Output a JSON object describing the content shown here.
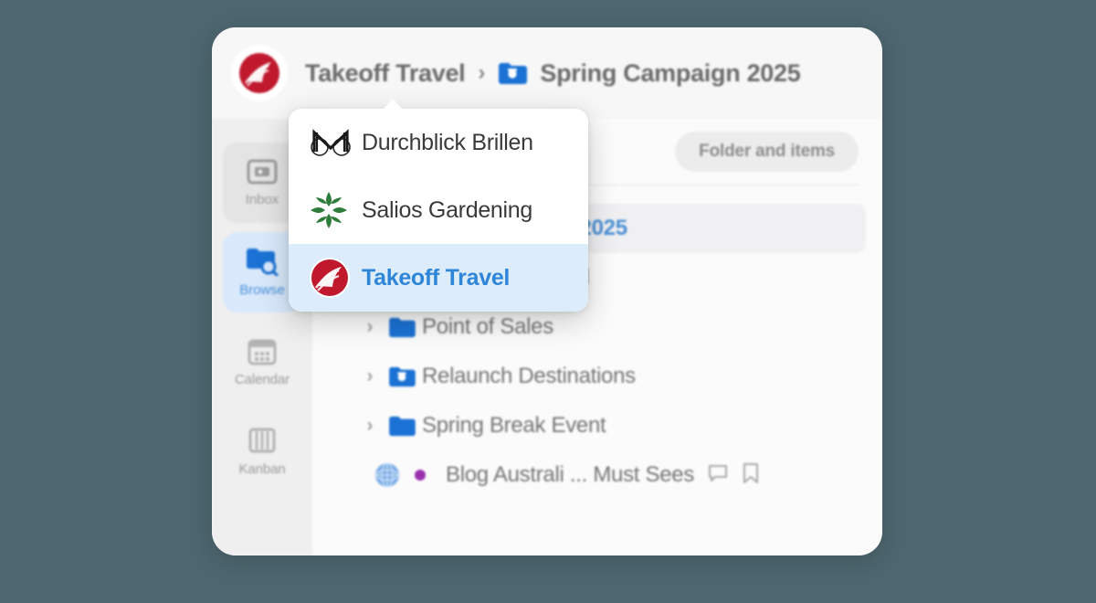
{
  "theme": {
    "page_background": "#4d666f",
    "card_background": "#f7f7f7",
    "accent_blue": "#2e86d8",
    "folder_blue": "#1b72d4",
    "brand_red": "#c0192e",
    "brand_green": "#2f7d3a",
    "dot_purple": "#9b30ae"
  },
  "header": {
    "logo_icon": "takeoff-travel-logo",
    "breadcrumb": [
      {
        "label": "Takeoff Travel",
        "icon": ""
      },
      {
        "label": "Spring Campaign 2025",
        "icon": "folder-media-icon"
      }
    ],
    "separator": "›"
  },
  "sidebar": {
    "items": [
      {
        "label": "Inbox",
        "icon": "inbox-icon",
        "state": "active-grey"
      },
      {
        "label": "Browse",
        "icon": "browse-icon",
        "state": "active-blue"
      },
      {
        "label": "Calendar",
        "icon": "calendar-icon",
        "state": ""
      },
      {
        "label": "Kanban",
        "icon": "kanban-icon",
        "state": ""
      }
    ]
  },
  "main": {
    "scope_pill": "Folder and items",
    "tree": [
      {
        "label": "Spring Campaign 2025",
        "icon": "folder-media-icon",
        "chevron": "›",
        "selected": true,
        "indent": 0
      },
      {
        "label": "Always-On Social",
        "icon": "folder-icon",
        "chevron": "›",
        "selected": false,
        "indent": 1
      },
      {
        "label": "Point of Sales",
        "icon": "folder-icon",
        "chevron": "›",
        "selected": false,
        "indent": 1
      },
      {
        "label": "Relaunch Destinations",
        "icon": "folder-media-icon",
        "chevron": "›",
        "selected": false,
        "indent": 1
      },
      {
        "label": "Spring Break Event",
        "icon": "folder-icon",
        "chevron": "›",
        "selected": false,
        "indent": 1
      }
    ],
    "leaf_row": {
      "icon": "globe-icon",
      "status_dot": "purple",
      "label": "Blog Australi  ... Must Sees",
      "trailing_icons": [
        "comment-icon",
        "bookmark-icon"
      ]
    }
  },
  "dropdown": {
    "items": [
      {
        "label": "Durchblick Brillen",
        "icon": "durchblick-brillen-logo",
        "selected": false
      },
      {
        "label": "Salios Gardening",
        "icon": "salios-gardening-logo",
        "selected": false
      },
      {
        "label": "Takeoff Travel",
        "icon": "takeoff-travel-logo",
        "selected": true
      }
    ]
  }
}
